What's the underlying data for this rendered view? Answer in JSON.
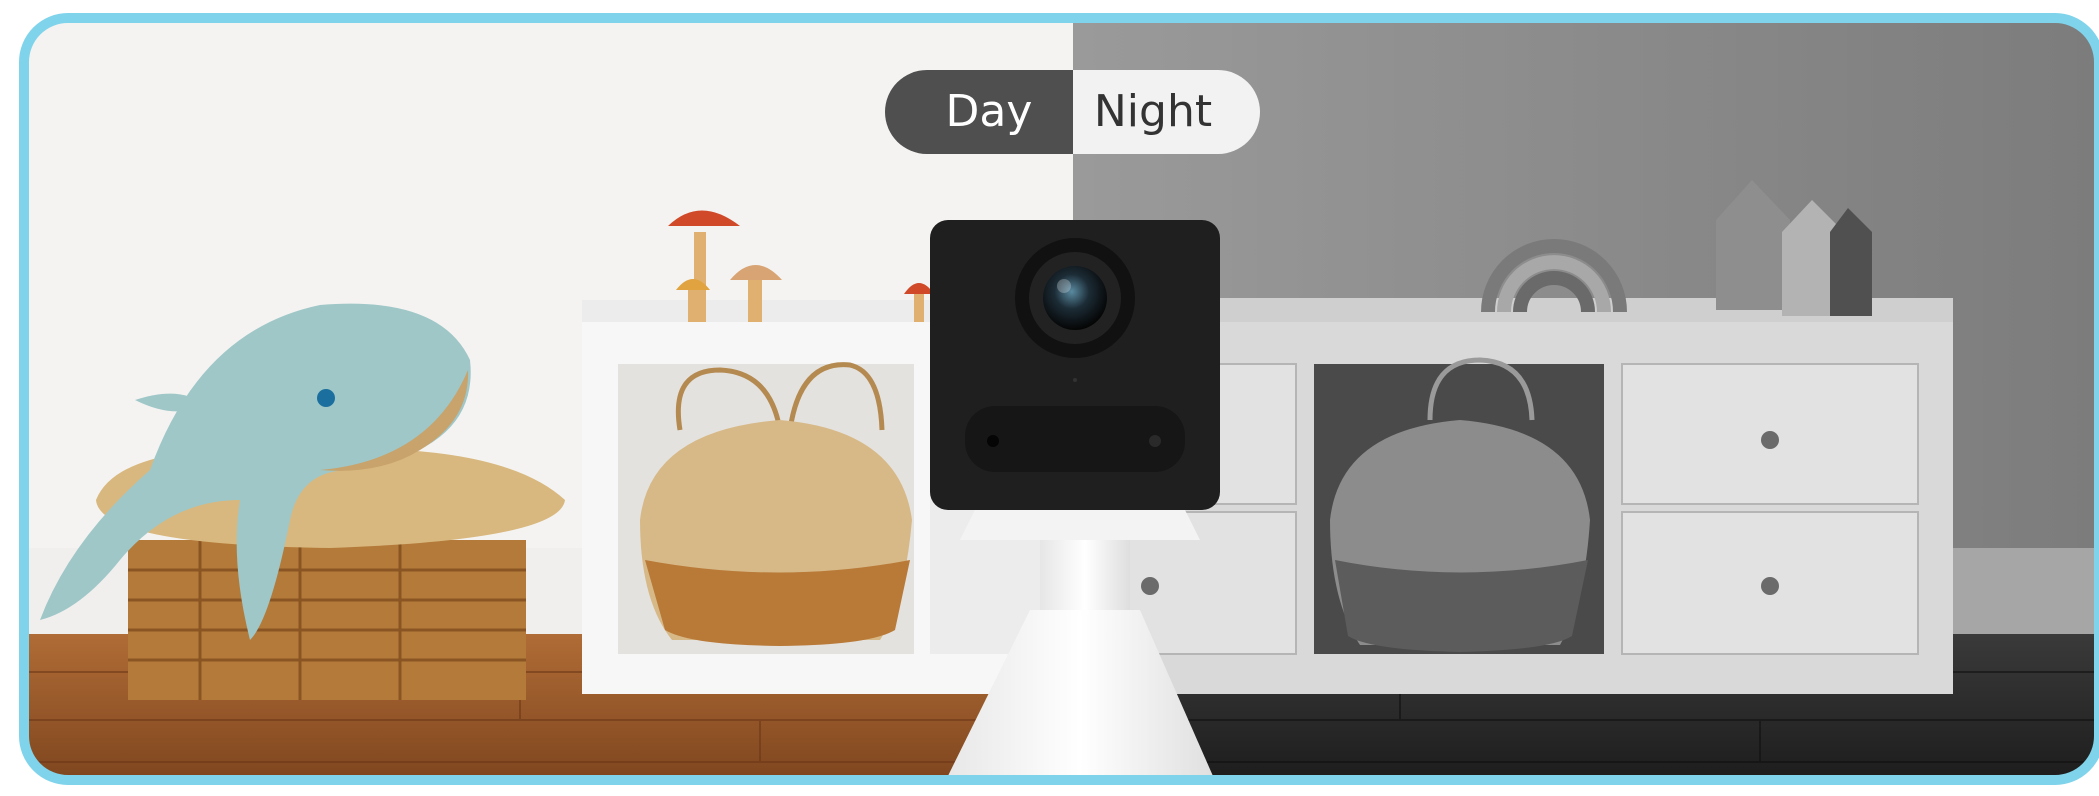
{
  "toggle": {
    "day_label": "Day",
    "night_label": "Night",
    "active": "Day"
  },
  "colors": {
    "frame_border": "#7fd3ea",
    "toggle_active_bg": "#4f4f4f",
    "toggle_inactive_bg": "#f2f2f2",
    "day_wall": "#f3f3f3",
    "night_wall": "#8a8a8a",
    "day_floor": "#9a5a2a",
    "night_floor": "#2e2e2e",
    "camera_body": "#1e1e1e"
  },
  "scene": {
    "left_half": "day-color-view",
    "right_half": "night-monochrome-view",
    "icons": [
      "whale-plush-icon",
      "basket-icon",
      "mushroom-icon",
      "camera-icon",
      "rainbow-stacker-icon",
      "house-decor-icon",
      "drawer-knob-icon"
    ]
  }
}
